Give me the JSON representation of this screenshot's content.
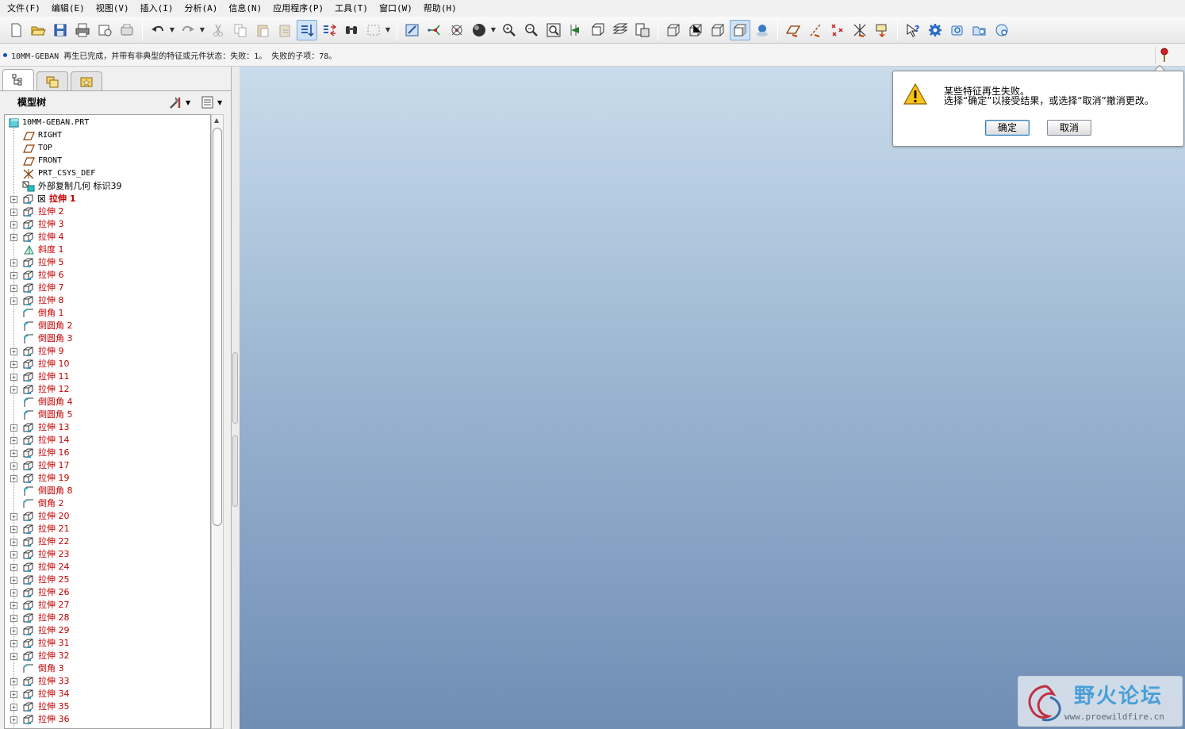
{
  "menu": [
    "文件(F)",
    "编辑(E)",
    "视图(V)",
    "插入(I)",
    "分析(A)",
    "信息(N)",
    "应用程序(P)",
    "工具(T)",
    "窗口(W)",
    "帮助(H)"
  ],
  "toolbar": {
    "groups": [
      [
        "new-file-icon",
        "open-file-icon",
        "save-icon",
        "print-icon",
        "send-mail-icon",
        "close-window-icon"
      ],
      [
        "undo-icon",
        "redo-icon",
        "cut-icon",
        "copy-icon",
        "paste-icon",
        "paste-special-icon",
        "regenerate-icon",
        "regen-manager-icon",
        "find-icon",
        "select-box-icon"
      ],
      [
        "repaint-icon",
        "spin-center-icon",
        "orient-mode-icon",
        "appearance-icon",
        "zoom-in-icon",
        "zoom-out-icon",
        "refit-icon",
        "reorient-icon",
        "saved-views-icon",
        "layers-icon",
        "view-manager-icon"
      ],
      [
        "wireframe-icon",
        "hidden-line-icon",
        "no-hidden-icon",
        "shading-icon",
        "enhanced-realism-icon"
      ],
      [
        "datum-planes-icon",
        "datum-axes-icon",
        "datum-points-icon",
        "coord-systems-icon",
        "annotation-icon"
      ],
      [
        "context-help-icon",
        "settings-gear-icon",
        "tool-a-icon",
        "tool-b-icon",
        "tool-c-icon"
      ]
    ]
  },
  "message_bar": {
    "text": "10MM-GEBAN 再生已完成，并带有非典型的特征或元件状态：失败：1。 失败的子项：78。"
  },
  "model_tree": {
    "title": "模型树",
    "root": "10MM-GEBAN.PRT",
    "items": [
      {
        "label": "RIGHT",
        "type": "plane",
        "style": "mono",
        "expand": false
      },
      {
        "label": "TOP",
        "type": "plane",
        "style": "mono",
        "expand": false
      },
      {
        "label": "FRONT",
        "type": "plane",
        "style": "mono",
        "expand": false
      },
      {
        "label": "PRT_CSYS_DEF",
        "type": "csys",
        "style": "mono",
        "expand": false
      },
      {
        "label": "外部复制几何 标识39",
        "type": "copygeom",
        "style": "black",
        "expand": false
      },
      {
        "label": "拉伸 1",
        "type": "extrude-fail",
        "style": "redbold",
        "expand": true
      },
      {
        "label": "拉伸 2",
        "type": "extrude",
        "style": "red",
        "expand": true
      },
      {
        "label": "拉伸 3",
        "type": "extrude",
        "style": "red",
        "expand": true
      },
      {
        "label": "拉伸 4",
        "type": "extrude",
        "style": "red",
        "expand": true
      },
      {
        "label": "斜度 1",
        "type": "draft",
        "style": "red",
        "expand": false
      },
      {
        "label": "拉伸 5",
        "type": "extrude",
        "style": "red",
        "expand": true
      },
      {
        "label": "拉伸 6",
        "type": "extrude",
        "style": "red",
        "expand": true
      },
      {
        "label": "拉伸 7",
        "type": "extrude",
        "style": "red",
        "expand": true
      },
      {
        "label": "拉伸 8",
        "type": "extrude",
        "style": "red",
        "expand": true
      },
      {
        "label": "倒角 1",
        "type": "chamfer",
        "style": "red",
        "expand": false
      },
      {
        "label": "倒圆角 2",
        "type": "round",
        "style": "red",
        "expand": false
      },
      {
        "label": "倒圆角 3",
        "type": "round",
        "style": "red",
        "expand": false
      },
      {
        "label": "拉伸 9",
        "type": "extrude",
        "style": "red",
        "expand": true
      },
      {
        "label": "拉伸 10",
        "type": "extrude",
        "style": "red",
        "expand": true
      },
      {
        "label": "拉伸 11",
        "type": "extrude",
        "style": "red",
        "expand": true
      },
      {
        "label": "拉伸 12",
        "type": "extrude",
        "style": "red",
        "expand": true
      },
      {
        "label": "倒圆角 4",
        "type": "round",
        "style": "red",
        "expand": false
      },
      {
        "label": "倒圆角 5",
        "type": "round",
        "style": "red",
        "expand": false
      },
      {
        "label": "拉伸 13",
        "type": "extrude",
        "style": "red",
        "expand": true
      },
      {
        "label": "拉伸 14",
        "type": "extrude",
        "style": "red",
        "expand": true
      },
      {
        "label": "拉伸 16",
        "type": "extrude",
        "style": "red",
        "expand": true
      },
      {
        "label": "拉伸 17",
        "type": "extrude",
        "style": "red",
        "expand": true
      },
      {
        "label": "拉伸 19",
        "type": "extrude",
        "style": "red",
        "expand": true
      },
      {
        "label": "倒圆角 8",
        "type": "round",
        "style": "red",
        "expand": false
      },
      {
        "label": "倒角 2",
        "type": "chamfer",
        "style": "red",
        "expand": false
      },
      {
        "label": "拉伸 20",
        "type": "extrude",
        "style": "red",
        "expand": true
      },
      {
        "label": "拉伸 21",
        "type": "extrude",
        "style": "red",
        "expand": true
      },
      {
        "label": "拉伸 22",
        "type": "extrude",
        "style": "red",
        "expand": true
      },
      {
        "label": "拉伸 23",
        "type": "extrude",
        "style": "red",
        "expand": true
      },
      {
        "label": "拉伸 24",
        "type": "extrude",
        "style": "red",
        "expand": true
      },
      {
        "label": "拉伸 25",
        "type": "extrude",
        "style": "red",
        "expand": true
      },
      {
        "label": "拉伸 26",
        "type": "extrude",
        "style": "red",
        "expand": true
      },
      {
        "label": "拉伸 27",
        "type": "extrude",
        "style": "red",
        "expand": true
      },
      {
        "label": "拉伸 28",
        "type": "extrude",
        "style": "red",
        "expand": true
      },
      {
        "label": "拉伸 29",
        "type": "extrude",
        "style": "red",
        "expand": true
      },
      {
        "label": "拉伸 31",
        "type": "extrude",
        "style": "red",
        "expand": true
      },
      {
        "label": "拉伸 32",
        "type": "extrude",
        "style": "red",
        "expand": true
      },
      {
        "label": "倒角 3",
        "type": "chamfer",
        "style": "red",
        "expand": false
      },
      {
        "label": "拉伸 33",
        "type": "extrude",
        "style": "red",
        "expand": true
      },
      {
        "label": "拉伸 34",
        "type": "extrude",
        "style": "red",
        "expand": true
      },
      {
        "label": "拉伸 35",
        "type": "extrude",
        "style": "red",
        "expand": true
      },
      {
        "label": "拉伸 36",
        "type": "extrude",
        "style": "red",
        "expand": true
      }
    ]
  },
  "dialog": {
    "line1": "某些特征再生失败。",
    "line2": "选择“确定”以接受结果，或选择“取消”撤消更改。",
    "ok_label": "确定",
    "cancel_label": "取消"
  },
  "watermark": {
    "title": "野火论坛",
    "url": "www.proewildfire.cn"
  },
  "colors": {
    "failed_feature": "#c00000",
    "viewport_top": "#c9dcec",
    "viewport_bottom": "#6f8db5",
    "accent": "#3c7fb1"
  }
}
